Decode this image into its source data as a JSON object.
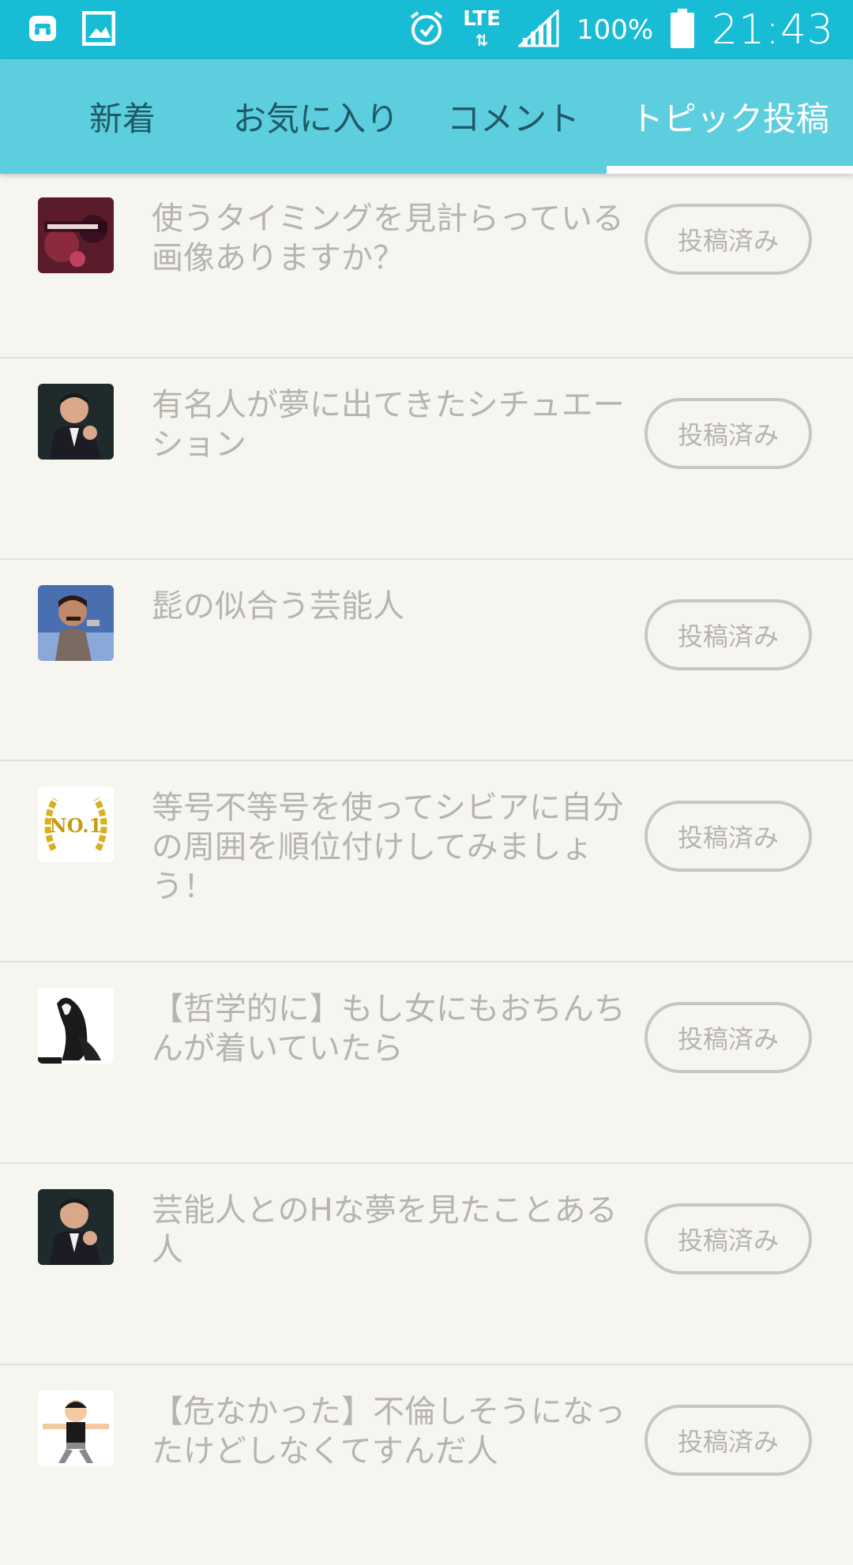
{
  "status_bar": {
    "network": "LTE",
    "battery": "100%",
    "time": "21:43",
    "icons": [
      "phone-missed-icon",
      "image-icon",
      "alarm-icon",
      "signal-icon",
      "battery-icon"
    ]
  },
  "tabs": [
    {
      "label": "新着"
    },
    {
      "label": "お気に入り"
    },
    {
      "label": "コメント"
    },
    {
      "label": "トピック投稿"
    }
  ],
  "active_tab": "トピック投稿",
  "colors": {
    "status_bar": "#18bcd5",
    "app_bar": "#5ccede",
    "background": "#f7f5ef",
    "tab_inactive_text": "#1e5a66",
    "muted_text": "#b6b4ae"
  },
  "posts": [
    {
      "title": "使うタイミングを見計らっている画像ありますか？",
      "status": "投稿済み",
      "thumb": "book-cover-thumbnail"
    },
    {
      "title": "有名人が夢に出てきたシチュエーション",
      "status": "投稿済み",
      "thumb": "man-in-suit-thumbnail"
    },
    {
      "title": "髭の似合う芸能人",
      "status": "投稿済み",
      "thumb": "mustache-singer-thumbnail"
    },
    {
      "title": "等号不等号を使ってシビアに自分の周囲を順位付けしてみましょう！",
      "status": "投稿済み",
      "thumb": "no1-laurel-thumbnail"
    },
    {
      "title": "【哲学的に】もし女にもおちんちんが着いていたら",
      "status": "投稿済み",
      "thumb": "dog-thumbnail"
    },
    {
      "title": "芸能人とのHな夢を見たことある人",
      "status": "投稿済み",
      "thumb": "man-in-suit-thumbnail"
    },
    {
      "title": "【危なかった】不倫しそうになったけどしなくてすんだ人",
      "status": "投稿済み",
      "thumb": "cartoon-man-thumbnail"
    }
  ]
}
